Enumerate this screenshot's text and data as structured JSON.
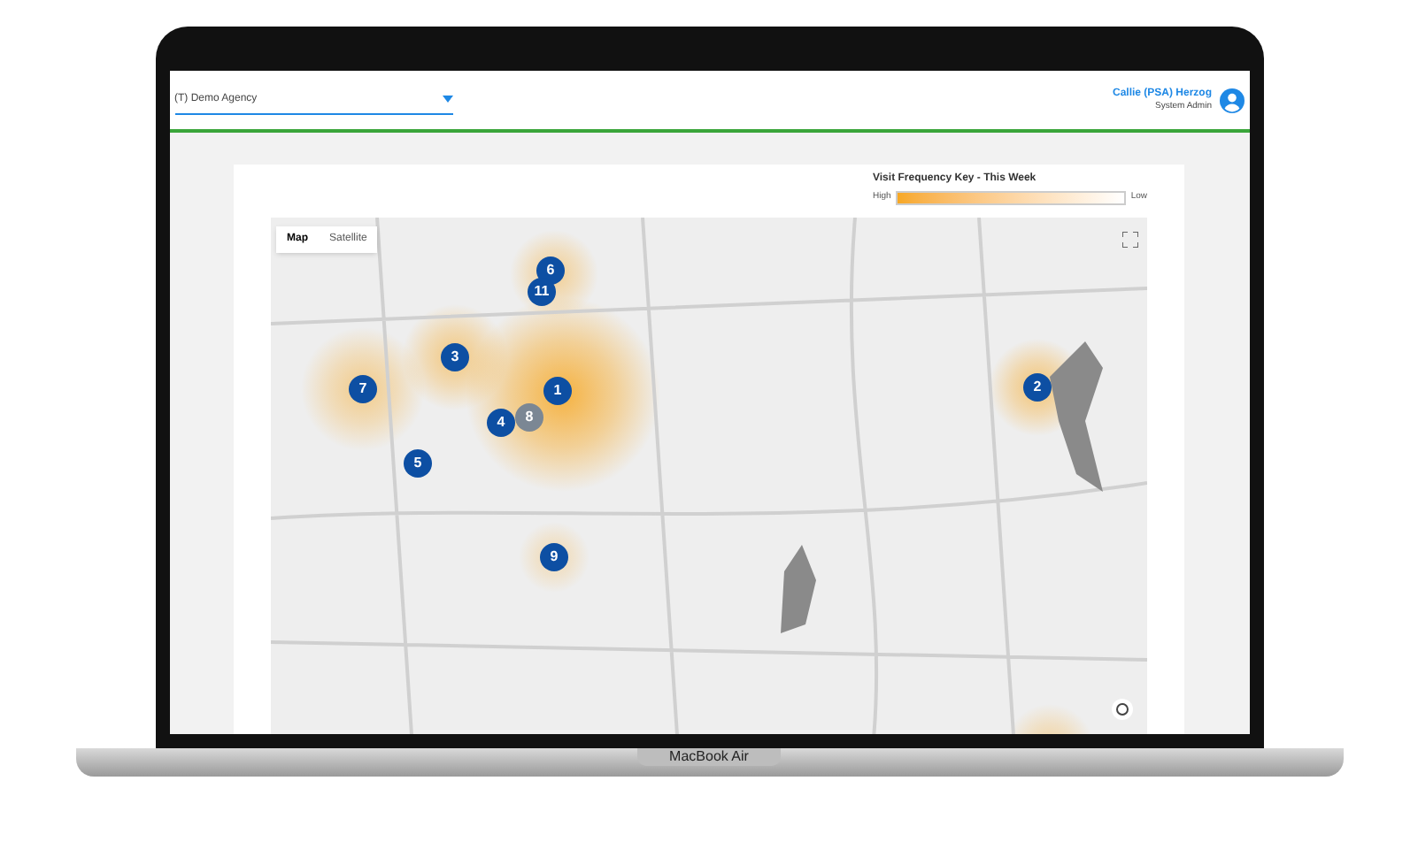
{
  "header": {
    "agency_select": {
      "value": "(T) Demo Agency"
    },
    "user": {
      "name": "Callie (PSA) Herzog",
      "role": "System Admin"
    }
  },
  "frequency_key": {
    "title": "Visit Frequency Key - This Week",
    "high_label": "High",
    "low_label": "Low"
  },
  "map": {
    "type_buttons": [
      {
        "label": "Map",
        "selected": true
      },
      {
        "label": "Satellite",
        "selected": false
      }
    ],
    "markers": [
      {
        "label": "1",
        "color": "#0d4fa3"
      },
      {
        "label": "2",
        "color": "#0d4fa3"
      },
      {
        "label": "3",
        "color": "#0d4fa3"
      },
      {
        "label": "4",
        "color": "#0d4fa3"
      },
      {
        "label": "5",
        "color": "#0d4fa3"
      },
      {
        "label": "6",
        "color": "#0d4fa3"
      },
      {
        "label": "7",
        "color": "#0d4fa3"
      },
      {
        "label": "8",
        "color": "#7b8794"
      },
      {
        "label": "9",
        "color": "#0d4fa3"
      },
      {
        "label": "11",
        "color": "#0d4fa3"
      }
    ]
  },
  "laptop": {
    "model_label": "MacBook Air"
  }
}
